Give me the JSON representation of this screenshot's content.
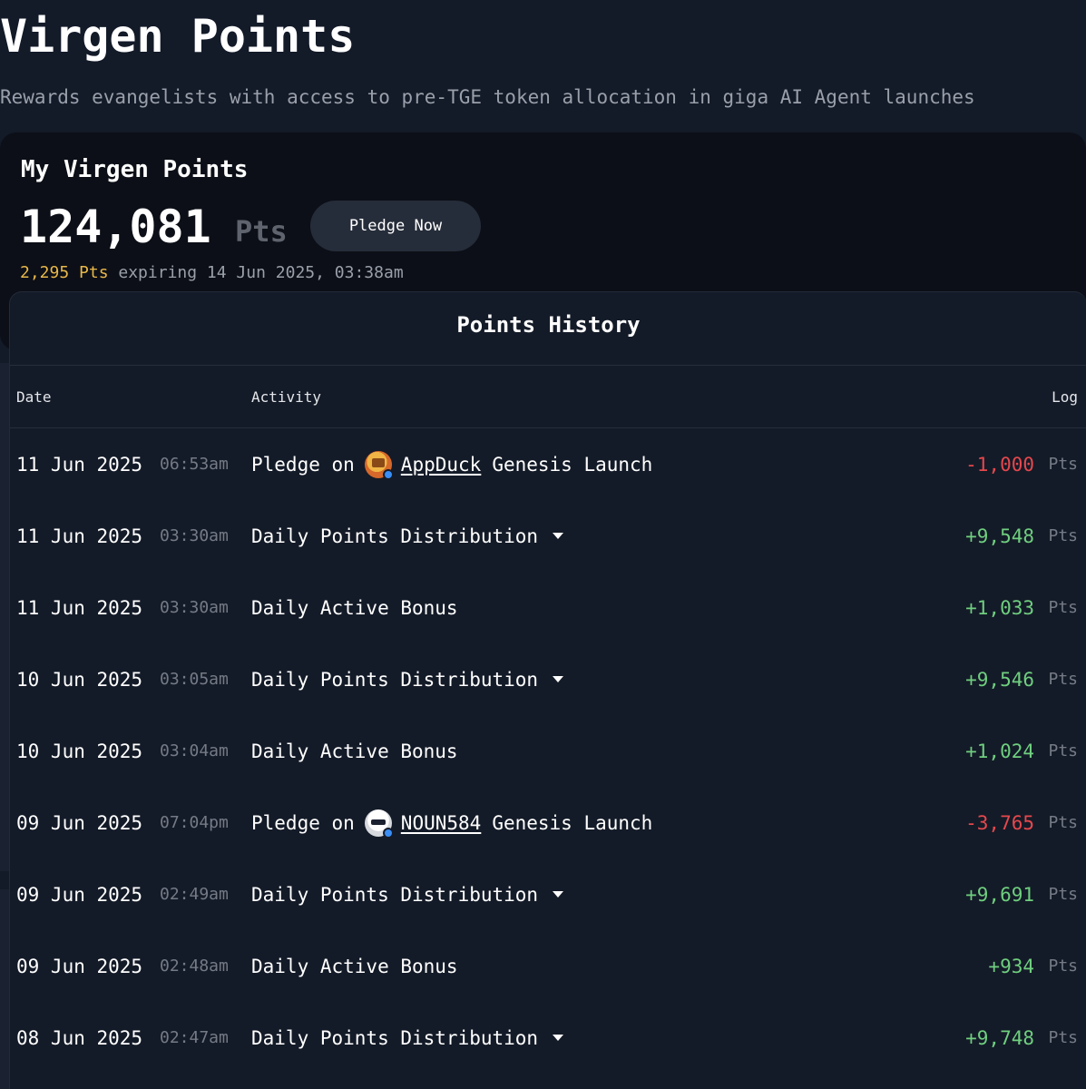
{
  "header": {
    "title": "Virgen Points",
    "subtitle": "Rewards evangelists with access to pre-TGE token allocation in giga AI Agent launches"
  },
  "summary": {
    "card_title": "My Virgen Points",
    "points": "124,081",
    "unit": "Pts",
    "pledge_label": "Pledge Now",
    "expiring_amount": "2,295 Pts",
    "expiring_text": " expiring 14 Jun 2025, 03:38am"
  },
  "history": {
    "title": "Points History",
    "columns": {
      "date": "Date",
      "activity": "Activity",
      "log": "Log"
    },
    "rows": [
      {
        "date": "11 Jun 2025",
        "time": "06:53am",
        "type": "pledge",
        "prefix": "Pledge on",
        "project": "AppDuck",
        "suffix": "Genesis Launch",
        "log": "-1,000",
        "unit": "Pts",
        "sign": "neg",
        "avatar": "duck-avatar"
      },
      {
        "date": "11 Jun 2025",
        "time": "03:30am",
        "type": "distribution",
        "activity": "Daily Points Distribution",
        "log": "+9,548",
        "unit": "Pts",
        "sign": "pos"
      },
      {
        "date": "11 Jun 2025",
        "time": "03:30am",
        "type": "bonus",
        "activity": "Daily Active Bonus",
        "log": "+1,033",
        "unit": "Pts",
        "sign": "pos"
      },
      {
        "date": "10 Jun 2025",
        "time": "03:05am",
        "type": "distribution",
        "activity": "Daily Points Distribution",
        "log": "+9,546",
        "unit": "Pts",
        "sign": "pos"
      },
      {
        "date": "10 Jun 2025",
        "time": "03:04am",
        "type": "bonus",
        "activity": "Daily Active Bonus",
        "log": "+1,024",
        "unit": "Pts",
        "sign": "pos"
      },
      {
        "date": "09 Jun 2025",
        "time": "07:04pm",
        "type": "pledge",
        "prefix": "Pledge on",
        "project": "NOUN584",
        "suffix": "Genesis Launch",
        "log": "-3,765",
        "unit": "Pts",
        "sign": "neg",
        "avatar": "noun-avatar"
      },
      {
        "date": "09 Jun 2025",
        "time": "02:49am",
        "type": "distribution",
        "activity": "Daily Points Distribution",
        "log": "+9,691",
        "unit": "Pts",
        "sign": "pos"
      },
      {
        "date": "09 Jun 2025",
        "time": "02:48am",
        "type": "bonus",
        "activity": "Daily Active Bonus",
        "log": "+934",
        "unit": "Pts",
        "sign": "pos"
      },
      {
        "date": "08 Jun 2025",
        "time": "02:47am",
        "type": "distribution",
        "activity": "Daily Points Distribution",
        "log": "+9,748",
        "unit": "Pts",
        "sign": "pos"
      }
    ]
  },
  "colors": {
    "background": "#131a28",
    "card": "#0c0f17",
    "accent_gold": "#e9b84a",
    "positive": "#6fcf7f",
    "negative": "#e5484d"
  }
}
